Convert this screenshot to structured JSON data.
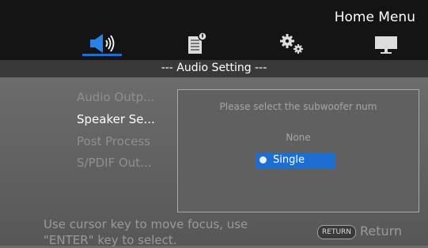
{
  "header": {
    "menu_title": "Home Menu",
    "tabs": [
      {
        "icon": "speaker-icon",
        "active": true
      },
      {
        "icon": "info-document-icon",
        "active": false
      },
      {
        "icon": "gears-icon",
        "active": false
      },
      {
        "icon": "monitor-icon",
        "active": false
      }
    ],
    "accent": "#1f6fcf"
  },
  "subheader": {
    "title": "--- Audio Setting ---"
  },
  "menu": {
    "items": [
      {
        "label": "Audio Outp...",
        "active": false
      },
      {
        "label": "Speaker Se...",
        "active": true
      },
      {
        "label": "Post Process",
        "active": false
      },
      {
        "label": "S/PDIF Out...",
        "active": false
      }
    ]
  },
  "dialog": {
    "prompt": "Please select the subwoofer num",
    "options": [
      {
        "label": "None",
        "selected": false
      },
      {
        "label": "Single",
        "selected": true
      }
    ]
  },
  "footer": {
    "help_line1": "Use cursor key to move focus, use",
    "help_line2": "\"ENTER\" key to select.",
    "return_key": "RETURN",
    "return_label": "Return"
  }
}
